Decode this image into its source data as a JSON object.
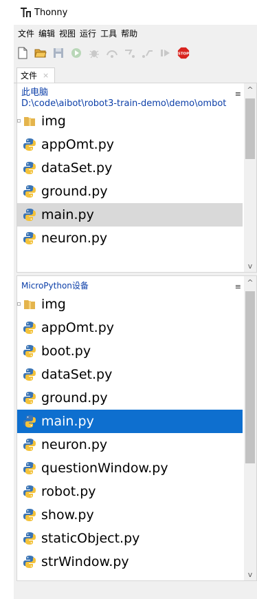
{
  "window": {
    "title": "Thonny"
  },
  "menu": {
    "items": [
      "文件",
      "编辑",
      "视图",
      "运行",
      "工具",
      "帮助"
    ]
  },
  "toolbar": {
    "buttons": [
      "new-file-icon",
      "open-folder-icon",
      "save-icon",
      "run-icon",
      "debug-icon",
      "step-over-icon",
      "step-into-icon",
      "step-out-icon",
      "resume-icon",
      "stop-icon"
    ],
    "stop_label": "STOP"
  },
  "tabs": [
    {
      "label": "文件",
      "close": "×"
    }
  ],
  "local": {
    "title": "此电脑",
    "path": "D:\\code\\aibot\\robot3-train-demo\\demo\\ombot",
    "menu_glyph": "≡",
    "items": [
      {
        "name": "img",
        "type": "folder"
      },
      {
        "name": "appOmt.py",
        "type": "python"
      },
      {
        "name": "dataSet.py",
        "type": "python"
      },
      {
        "name": "ground.py",
        "type": "python"
      },
      {
        "name": "main.py",
        "type": "python",
        "selected": true
      },
      {
        "name": "neuron.py",
        "type": "python"
      }
    ]
  },
  "device": {
    "title": "MicroPython设备",
    "menu_glyph": "≡",
    "items": [
      {
        "name": "img",
        "type": "folder"
      },
      {
        "name": "appOmt.py",
        "type": "python"
      },
      {
        "name": "boot.py",
        "type": "python"
      },
      {
        "name": "dataSet.py",
        "type": "python"
      },
      {
        "name": "ground.py",
        "type": "python"
      },
      {
        "name": "main.py",
        "type": "python",
        "selected": true
      },
      {
        "name": "neuron.py",
        "type": "python"
      },
      {
        "name": "questionWindow.py",
        "type": "python"
      },
      {
        "name": "robot.py",
        "type": "python"
      },
      {
        "name": "show.py",
        "type": "python"
      },
      {
        "name": "staticObject.py",
        "type": "python"
      },
      {
        "name": "strWindow.py",
        "type": "python"
      }
    ]
  },
  "scroll": {
    "up": "^",
    "down": "v"
  },
  "colors": {
    "accent": "#0e6fcf",
    "header_text": "#0b3ea8",
    "selected_gray": "#d9d9d9"
  }
}
